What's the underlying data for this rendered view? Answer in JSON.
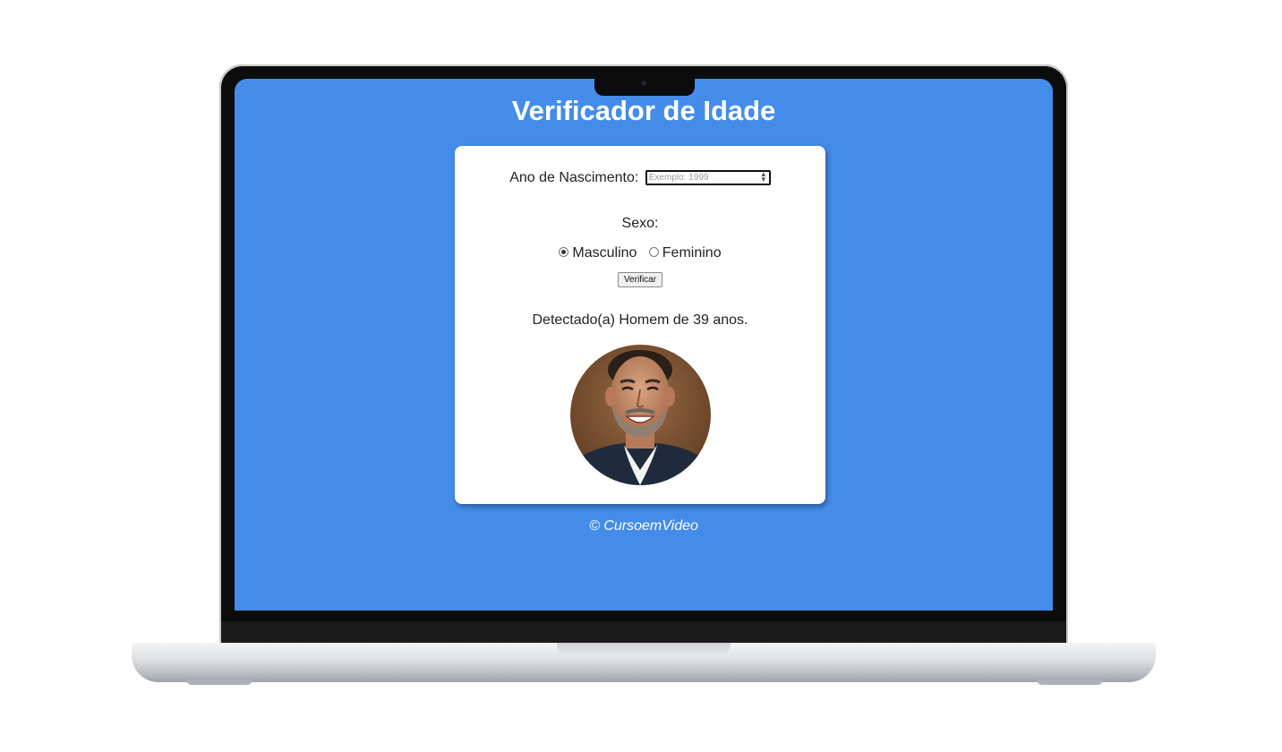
{
  "page": {
    "title": "Verificador de Idade",
    "footer": "© CursoemVideo"
  },
  "form": {
    "year_label": "Ano de Nascimento:",
    "year_placeholder": "Exemplo: 1999",
    "sex_label": "Sexo:",
    "options": [
      {
        "label": "Masculino",
        "checked": true
      },
      {
        "label": "Feminino",
        "checked": false
      }
    ],
    "button_label": "Verificar"
  },
  "result": {
    "text": "Detectado(a) Homem de 39 anos.",
    "image": "man-portrait"
  },
  "colors": {
    "background": "#448ce9",
    "card": "#ffffff",
    "text": "#222222"
  }
}
